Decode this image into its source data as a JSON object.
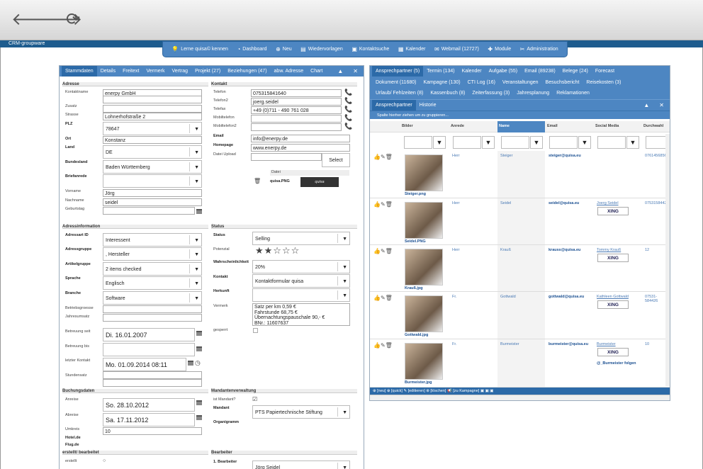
{
  "browser": {
    "back": "🡐",
    "forward": "🡒",
    "reload": "⟳"
  },
  "app": {
    "brand": "CRM-groupware"
  },
  "menu": [
    {
      "icon": "💡",
      "label": "Lerne quisa© kennen"
    },
    {
      "icon": "◔",
      "label": "Dashboard"
    },
    {
      "icon": "⊕",
      "label": "Neu"
    },
    {
      "icon": "▤",
      "label": "Wiedervorlagen"
    },
    {
      "icon": "▣",
      "label": "Kontaktsuche"
    },
    {
      "icon": "▦",
      "label": "Kalender"
    },
    {
      "icon": "✉",
      "label": "Webmail (12727)"
    },
    {
      "icon": "✚",
      "label": "Module"
    },
    {
      "icon": "✂",
      "label": "Administration"
    }
  ],
  "left_tabs": [
    "Stammdaten",
    "Details",
    "Freitext",
    "Vermerk",
    "Vertrag",
    "Projekt (27)",
    "Beziehungen (47)",
    "abw. Adresse",
    "Chart"
  ],
  "adresse": {
    "section": "Adresse",
    "kontaktname_l": "Kontaktname",
    "kontaktname": "enerpy GmbH",
    "zusatz_l": "Zusatz",
    "strasse_l": "Strasse",
    "strasse": "Lohnerhofstraße 2",
    "plz_l": "PLZ",
    "plz": "78647",
    "ort_l": "Ort",
    "ort": "Konstanz",
    "land_l": "Land",
    "land": "DE",
    "bundesland_l": "Bundesland",
    "bundesland": "Baden Württemberg",
    "briefanrede_l": "Briefanrede",
    "vorname_l": "Vorname",
    "vorname": "Jörg",
    "nachname_l": "Nachname",
    "nachname": "seidel",
    "geburtstag_l": "Geburtstag"
  },
  "kontakt": {
    "section": "Kontakt",
    "telefon_l": "Telefon",
    "telefon": "075315841640",
    "telefon2_l": "Telefon2",
    "telefon2": "joerg.seidel",
    "telefax_l": "Telefax",
    "telefax": "+49 (0)711 - 490 761 028",
    "mobil_l": "Mobiltelefon",
    "mobil2_l": "Mobiltelefon2",
    "email_l": "Email",
    "email": "info@enerpy.de",
    "homepage_l": "Homepage",
    "homepage": "www.enerpy.de",
    "upload_l": "Datei Upload",
    "select": "Select",
    "datei_h": "Datei",
    "file": "quisa.PNG",
    "logo": "quisa"
  },
  "adressinfo": {
    "section": "Adressinformation",
    "adressart_l": "Adressart ID",
    "adressart": "Interessent",
    "gruppe_l": "Adressgruppe",
    "gruppe": ", Hersteller",
    "artikel_l": "Artikelgruppe",
    "artikel": "2 items checked",
    "sprache_l": "Sprache",
    "sprache": "Englisch",
    "branche_l": "Branche",
    "branche": "Software",
    "betrieb_l": "Betriebsgroesse",
    "jahresumsatz_l": "Jahresumsatz",
    "seit_l": "Betreuung seit",
    "seit": "Di. 16.01.2007",
    "bis_l": "Betreuung bis",
    "letzter_l": "letzter Kontakt",
    "letzter": "Mo. 01.09.2014 08:11",
    "stundensatz_l": "Stundensatz"
  },
  "status": {
    "section": "Status",
    "status_l": "Status",
    "status": "Selling",
    "potenzial_l": "Potenzial",
    "stars": 2,
    "stars_max": 5,
    "wahr_l": "Wahrscheinlichkeit",
    "wahr": "20%",
    "kontakt_l": "Kontakt",
    "kontakt": "Kontaktformular quisa",
    "herkunft_l": "Herkunft",
    "vermerk_l": "Vermerk",
    "vermerk": [
      "Satz per km 0,59 €",
      "Fahrstunde 68,75 €",
      "Übernachtungspauschale 90,- €",
      "BNr.: 11607637"
    ],
    "gesperrt_l": "gesperrt"
  },
  "buchung": {
    "section": "Buchungsdaten",
    "anreise_l": "Anreise",
    "anreise": "So. 28.10.2012",
    "abreise_l": "Abreise",
    "abreise": "Sa. 17.11.2012",
    "umkreis_l": "Umkreis",
    "umkreis": "10",
    "hotel_l": "Hotel.de",
    "flug_l": "Flug.de"
  },
  "mandant": {
    "section": "Mandantenverwaltung",
    "ist_l": "ist Mandant?",
    "mandant_l": "Mandant",
    "mandant": "PTS Papiertechnische Stiftung",
    "organigramm_l": "Organigramm"
  },
  "erstellt": {
    "section": "erstellt/ bearbeitet",
    "erstellt_l": "erstellt"
  },
  "bearbeiter": {
    "section": "Bearbeiter",
    "b1_l": "1. Bearbeiter",
    "b1": "Jörg Seidel"
  },
  "right_tabs_row1": [
    "Ansprechpartner (5)",
    "Termin (134)",
    "Kalender",
    "Aufgabe (55)",
    "Email (89238)",
    "Belege (24)",
    "Forecast"
  ],
  "right_tabs_row2": [
    "Dokument (11680)",
    "Kampagne (130)",
    "CTI Log (16)",
    "Veranstaltungen",
    "Besuchsbericht",
    "Reisekosten (3)"
  ],
  "right_tabs_row3": [
    "Urlaub/ Fehlzeiten (8)",
    "Kassenbuch (8)",
    "Zeiterfassung (3)",
    "Jahresplanung",
    "Reklamationen"
  ],
  "right_subtabs": [
    "Ansprechpartner",
    "Historie"
  ],
  "grid": {
    "groupbar": "Spalte hierher ziehen um zu gruppieren...",
    "cols": [
      "Bilder",
      "Anrede",
      "Name",
      "Email",
      "Social Media",
      "Durchwahl"
    ],
    "rows": [
      {
        "img": "Steiger.png",
        "anrede": "Herr",
        "name": "Steiger",
        "email": "steiger@quisa.eu",
        "social": "",
        "xing": false,
        "tel": "07614568568"
      },
      {
        "img": "Seidel.PNG",
        "anrede": "Herr",
        "name": "Seidel",
        "email": "seidel@quisa.eu",
        "social": "Joerg Seidel",
        "xing": true,
        "tel": "075315844263"
      },
      {
        "img": "Krauß.jpg",
        "anrede": "Herr",
        "name": "Krauß",
        "email": "krauss@quisa.eu",
        "social": "Tommy Krauß",
        "xing": true,
        "tel": "12"
      },
      {
        "img": "Gottwald.jpg",
        "anrede": "Fr.",
        "name": "Gottwald",
        "email": "gottwald@quisa.eu",
        "social": "Kathleen Gottwald",
        "xing": true,
        "tel": "07531-584426"
      },
      {
        "img": "Burmeister.jpg",
        "anrede": "Fr.",
        "name": "Burmeister",
        "email": "burmeister@quisa.eu",
        "social": "Burmeister",
        "xing": true,
        "social2": "@_Burmeister folgen",
        "tel": "10"
      }
    ],
    "xing_label": "XING",
    "footer": "⊕ [neu]  ⊕ [quick]  ✎ [editieren]  ⊗ [löschen]  📢 [zu Kampagne]  ▣  ▣  ▣"
  }
}
